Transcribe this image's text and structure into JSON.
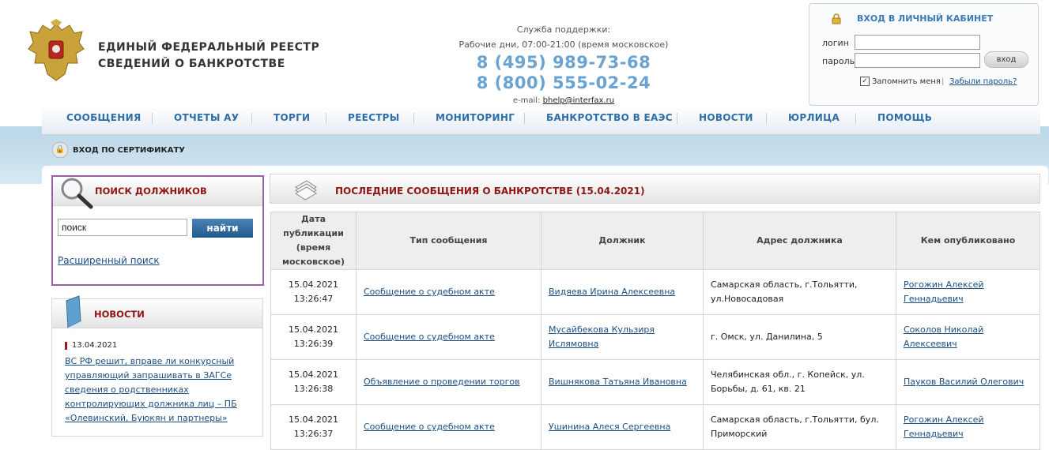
{
  "site": {
    "title_line1": "ЕДИНЫЙ  ФЕДЕРАЛЬНЫЙ  РЕЕСТР",
    "title_line2": "СВЕДЕНИЙ О БАНКРОТСТВЕ"
  },
  "support": {
    "label": "Служба поддержки:",
    "hours": "Рабочие дни, 07:00-21:00 (время московское)",
    "phone1": "8 (495) 989-73-68",
    "phone2": "8 (800) 555-02-24",
    "email_label": "e-mail:",
    "email": "bhelp@interfax.ru"
  },
  "login": {
    "title": "ВХОД В ЛИЧНЫЙ КАБИНЕТ",
    "login_label": "логин",
    "password_label": "пароль",
    "login_value": "",
    "password_value": "",
    "submit": "вход",
    "remember": "Запомнить меня",
    "remember_checked": true,
    "separator": "|",
    "forgot": "Забыли пароль?"
  },
  "nav": [
    "СООБЩЕНИЯ",
    "ОТЧЕТЫ АУ",
    "ТОРГИ",
    "РЕЕСТРЫ",
    "МОНИТОРИНГ",
    "БАНКРОТСТВО В ЕАЭС",
    "НОВОСТИ",
    "ЮРЛИЦА",
    "ПОМОЩЬ"
  ],
  "cert_login": "ВХОД ПО СЕРТИФИКАТУ",
  "debtor_search": {
    "title": "ПОИСК ДОЛЖНИКОВ",
    "input_value": "поиск",
    "button": "найти",
    "advanced": "Расширенный поиск"
  },
  "news": {
    "title": "НОВОСТИ",
    "date": "13.04.2021",
    "text": "ВС РФ решит, вправе ли конкурсный управляющий запрашивать в ЗАГСе сведения о родственниках контролирующих должника лиц – ПБ «Олевинский, Буюкян и партнеры»"
  },
  "messages": {
    "title": "ПОСЛЕДНИЕ СООБЩЕНИЯ О БАНКРОТСТВЕ (15.04.2021)",
    "headers": [
      "Дата публикации (время московское)",
      "Тип сообщения",
      "Должник",
      "Адрес должника",
      "Кем опубликовано"
    ],
    "rows": [
      {
        "date": "15.04.2021",
        "time": "13:26:47",
        "type": "Сообщение о судебном акте",
        "debtor": "Видяева Ирина Алексеевна",
        "address": "Самарская область, г.Тольятти, ул.Новосадовая",
        "publisher": "Рогожин Алексей Геннадьевич"
      },
      {
        "date": "15.04.2021",
        "time": "13:26:39",
        "type": "Сообщение о судебном акте",
        "debtor": "Мусайбекова Кульзиря Ислямовна",
        "address": "г. Омск, ул. Данилина, 5",
        "publisher": "Соколов Николай Алексеевич"
      },
      {
        "date": "15.04.2021",
        "time": "13:26:38",
        "type": "Объявление о проведении торгов",
        "debtor": "Вишнякова Татьяна Ивановна",
        "address": "Челябинская обл., г. Копейск, ул. Борьбы, д. 61, кв. 21",
        "publisher": "Пауков Василий Олегович"
      },
      {
        "date": "15.04.2021",
        "time": "13:26:37",
        "type": "Сообщение о судебном акте",
        "debtor": "Ушинина Алеся Сергеевна",
        "address": "Самарская область, г.Тольятти, бул. Приморский",
        "publisher": "Рогожин Алексей Геннадьевич"
      }
    ]
  }
}
